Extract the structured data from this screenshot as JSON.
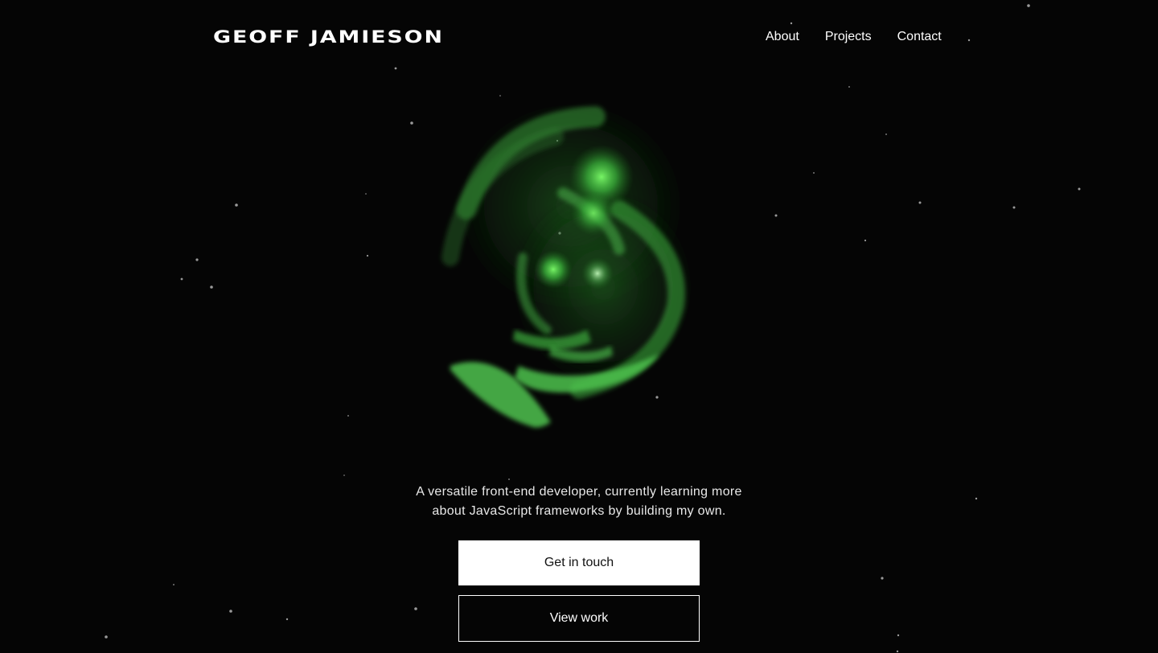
{
  "header": {
    "logo_text": "GEOFF JAMIESON",
    "nav": {
      "about": "About",
      "projects": "Projects",
      "contact": "Contact"
    }
  },
  "hero": {
    "tagline_line1": "A versatile front-end developer, currently learning more",
    "tagline_line2": "about JavaScript frameworks by building my own.",
    "primary_cta": "Get in touch",
    "secondary_cta": "View work"
  },
  "colors": {
    "background": "#050505",
    "accent": "#3fbf3f",
    "text": "#ffffff"
  }
}
